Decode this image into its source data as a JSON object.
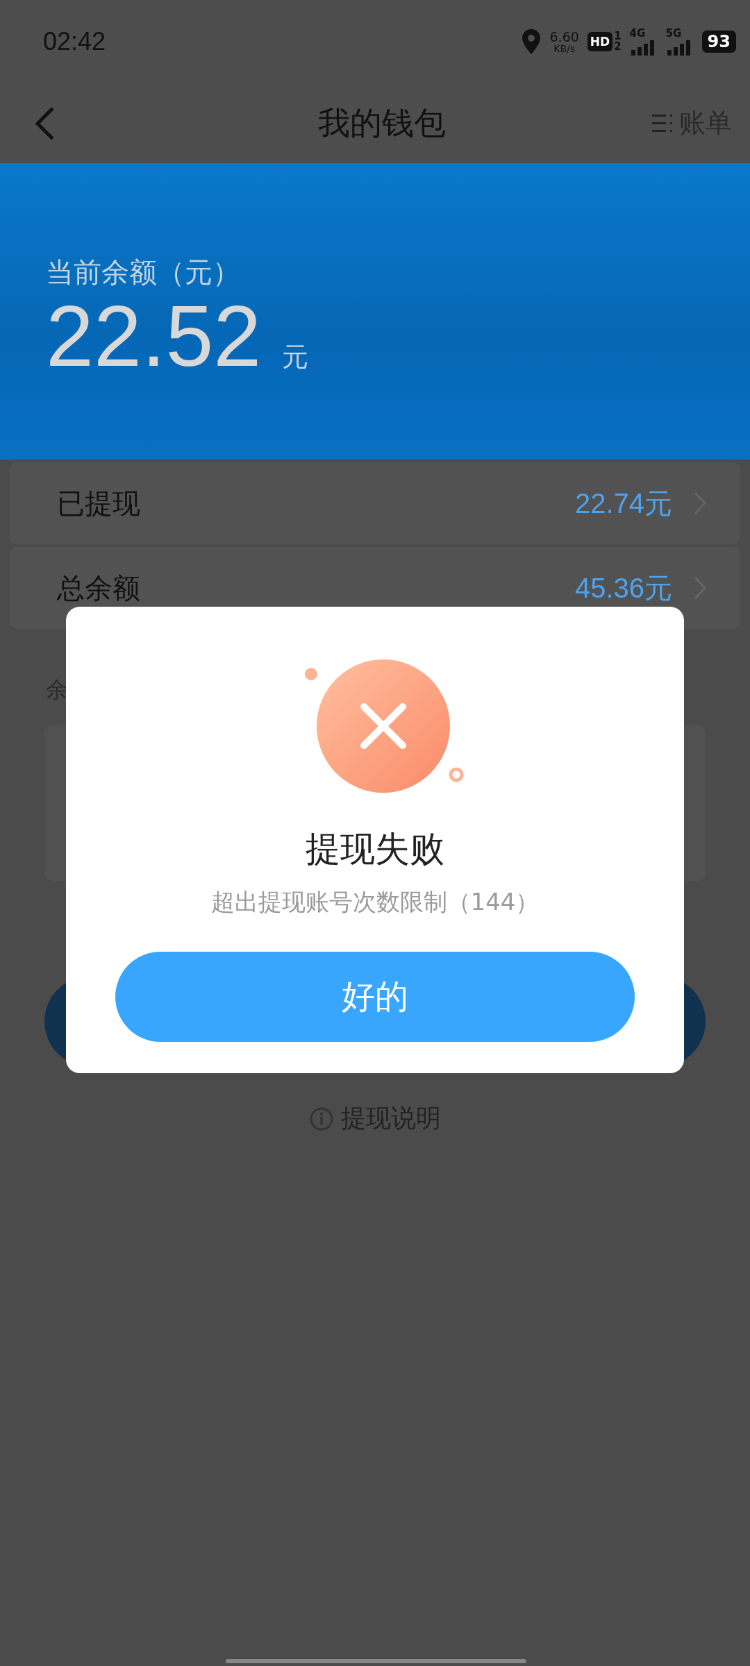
{
  "status_bar": {
    "time": "02:42",
    "net_speed": "6.60",
    "net_unit": "KB/s",
    "hd": "HD",
    "sim_1": "1",
    "sim_2": "2",
    "networks": [
      "4G",
      "5G"
    ],
    "battery": "93"
  },
  "nav": {
    "title": "我的钱包",
    "action": "账单"
  },
  "balance": {
    "label": "当前余额（元）",
    "amount": "22.52",
    "unit": "元"
  },
  "rows": [
    {
      "label": "已提现",
      "value": "22.74元"
    },
    {
      "label": "总余额",
      "value": "45.36元"
    }
  ],
  "section_label": "余",
  "help_link": "提现说明",
  "dialog": {
    "title": "提现失败",
    "message": "超出提现账号次数限制（144）",
    "button": "好的"
  }
}
